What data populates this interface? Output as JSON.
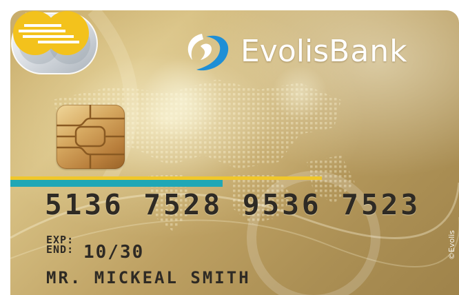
{
  "card": {
    "bank_name_part1": "Evolis",
    "bank_name_part2": "Bank",
    "number": "5136 7528 9536 7523",
    "expiry_label": "EXP:\nEND:",
    "expiry_value": "10/30",
    "cardholder": "MR. MICKEAL SMITH",
    "watermark": "©Evolis"
  },
  "icons": {
    "back": "chevron-left-icon",
    "logo": "evolis-logo-icon",
    "chip": "emv-chip-icon",
    "contactless": "globe-hologram-icon",
    "brand": "mastercard-style-icon"
  },
  "colors": {
    "card_gold": "#c8ac6a",
    "stripe_blue": "#1fa7b6",
    "stripe_yellow": "#f0c72a",
    "logo_blue": "#1f8fd6",
    "text_dark": "#2e2a24"
  }
}
